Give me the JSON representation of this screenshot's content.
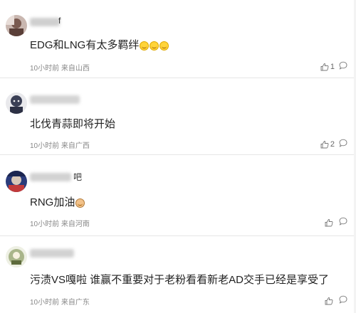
{
  "comments": [
    {
      "username_tail": "f",
      "text": "EDG和LNG有太多羁绊",
      "meta": "10小时前 来自山西",
      "likes": "1"
    },
    {
      "username_tail": "",
      "text": "北伐青蒜即将开始",
      "meta": "10小时前 来自广西",
      "likes": "2"
    },
    {
      "username_tail": "吧",
      "text": "RNG加油",
      "meta": "10小时前 来自河南",
      "likes": ""
    },
    {
      "username_tail": "",
      "text": "污渍VS嘎啦 谁赢不重要对于老粉看看新老AD交手已经是享受了",
      "meta": "10小时前 来自广东",
      "likes": ""
    }
  ],
  "icons": {
    "like": "thumbs-up-icon",
    "reply": "comment-bubble-icon"
  },
  "colors": {
    "text": "#222222",
    "meta": "#888888",
    "divider": "#e6e6e6"
  }
}
